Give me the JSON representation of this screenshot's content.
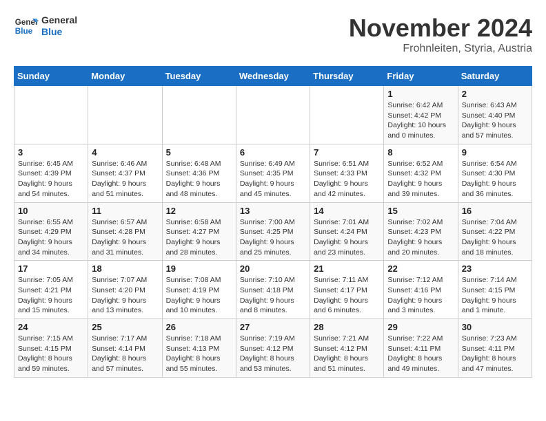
{
  "logo": {
    "line1": "General",
    "line2": "Blue"
  },
  "title": "November 2024",
  "subtitle": "Frohnleiten, Styria, Austria",
  "days_of_week": [
    "Sunday",
    "Monday",
    "Tuesday",
    "Wednesday",
    "Thursday",
    "Friday",
    "Saturday"
  ],
  "weeks": [
    [
      {
        "day": "",
        "info": ""
      },
      {
        "day": "",
        "info": ""
      },
      {
        "day": "",
        "info": ""
      },
      {
        "day": "",
        "info": ""
      },
      {
        "day": "",
        "info": ""
      },
      {
        "day": "1",
        "info": "Sunrise: 6:42 AM\nSunset: 4:42 PM\nDaylight: 10 hours\nand 0 minutes."
      },
      {
        "day": "2",
        "info": "Sunrise: 6:43 AM\nSunset: 4:40 PM\nDaylight: 9 hours\nand 57 minutes."
      }
    ],
    [
      {
        "day": "3",
        "info": "Sunrise: 6:45 AM\nSunset: 4:39 PM\nDaylight: 9 hours\nand 54 minutes."
      },
      {
        "day": "4",
        "info": "Sunrise: 6:46 AM\nSunset: 4:37 PM\nDaylight: 9 hours\nand 51 minutes."
      },
      {
        "day": "5",
        "info": "Sunrise: 6:48 AM\nSunset: 4:36 PM\nDaylight: 9 hours\nand 48 minutes."
      },
      {
        "day": "6",
        "info": "Sunrise: 6:49 AM\nSunset: 4:35 PM\nDaylight: 9 hours\nand 45 minutes."
      },
      {
        "day": "7",
        "info": "Sunrise: 6:51 AM\nSunset: 4:33 PM\nDaylight: 9 hours\nand 42 minutes."
      },
      {
        "day": "8",
        "info": "Sunrise: 6:52 AM\nSunset: 4:32 PM\nDaylight: 9 hours\nand 39 minutes."
      },
      {
        "day": "9",
        "info": "Sunrise: 6:54 AM\nSunset: 4:30 PM\nDaylight: 9 hours\nand 36 minutes."
      }
    ],
    [
      {
        "day": "10",
        "info": "Sunrise: 6:55 AM\nSunset: 4:29 PM\nDaylight: 9 hours\nand 34 minutes."
      },
      {
        "day": "11",
        "info": "Sunrise: 6:57 AM\nSunset: 4:28 PM\nDaylight: 9 hours\nand 31 minutes."
      },
      {
        "day": "12",
        "info": "Sunrise: 6:58 AM\nSunset: 4:27 PM\nDaylight: 9 hours\nand 28 minutes."
      },
      {
        "day": "13",
        "info": "Sunrise: 7:00 AM\nSunset: 4:25 PM\nDaylight: 9 hours\nand 25 minutes."
      },
      {
        "day": "14",
        "info": "Sunrise: 7:01 AM\nSunset: 4:24 PM\nDaylight: 9 hours\nand 23 minutes."
      },
      {
        "day": "15",
        "info": "Sunrise: 7:02 AM\nSunset: 4:23 PM\nDaylight: 9 hours\nand 20 minutes."
      },
      {
        "day": "16",
        "info": "Sunrise: 7:04 AM\nSunset: 4:22 PM\nDaylight: 9 hours\nand 18 minutes."
      }
    ],
    [
      {
        "day": "17",
        "info": "Sunrise: 7:05 AM\nSunset: 4:21 PM\nDaylight: 9 hours\nand 15 minutes."
      },
      {
        "day": "18",
        "info": "Sunrise: 7:07 AM\nSunset: 4:20 PM\nDaylight: 9 hours\nand 13 minutes."
      },
      {
        "day": "19",
        "info": "Sunrise: 7:08 AM\nSunset: 4:19 PM\nDaylight: 9 hours\nand 10 minutes."
      },
      {
        "day": "20",
        "info": "Sunrise: 7:10 AM\nSunset: 4:18 PM\nDaylight: 9 hours\nand 8 minutes."
      },
      {
        "day": "21",
        "info": "Sunrise: 7:11 AM\nSunset: 4:17 PM\nDaylight: 9 hours\nand 6 minutes."
      },
      {
        "day": "22",
        "info": "Sunrise: 7:12 AM\nSunset: 4:16 PM\nDaylight: 9 hours\nand 3 minutes."
      },
      {
        "day": "23",
        "info": "Sunrise: 7:14 AM\nSunset: 4:15 PM\nDaylight: 9 hours\nand 1 minute."
      }
    ],
    [
      {
        "day": "24",
        "info": "Sunrise: 7:15 AM\nSunset: 4:15 PM\nDaylight: 8 hours\nand 59 minutes."
      },
      {
        "day": "25",
        "info": "Sunrise: 7:17 AM\nSunset: 4:14 PM\nDaylight: 8 hours\nand 57 minutes."
      },
      {
        "day": "26",
        "info": "Sunrise: 7:18 AM\nSunset: 4:13 PM\nDaylight: 8 hours\nand 55 minutes."
      },
      {
        "day": "27",
        "info": "Sunrise: 7:19 AM\nSunset: 4:12 PM\nDaylight: 8 hours\nand 53 minutes."
      },
      {
        "day": "28",
        "info": "Sunrise: 7:21 AM\nSunset: 4:12 PM\nDaylight: 8 hours\nand 51 minutes."
      },
      {
        "day": "29",
        "info": "Sunrise: 7:22 AM\nSunset: 4:11 PM\nDaylight: 8 hours\nand 49 minutes."
      },
      {
        "day": "30",
        "info": "Sunrise: 7:23 AM\nSunset: 4:11 PM\nDaylight: 8 hours\nand 47 minutes."
      }
    ]
  ]
}
